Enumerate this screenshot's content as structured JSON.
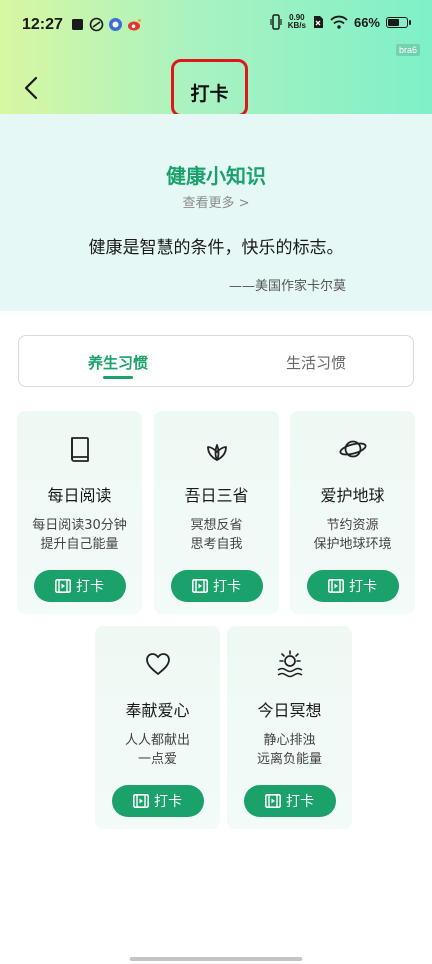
{
  "status_bar": {
    "time": "12:27",
    "net_speed_value": "0.90",
    "net_speed_unit": "KB/s",
    "battery_percent": "66%",
    "battery_level": 0.66,
    "device_tag": "bra6"
  },
  "header": {
    "title": "打卡",
    "back_icon": "chevron-left-icon"
  },
  "knowledge": {
    "title": "健康小知识",
    "more_link": "查看更多 >",
    "quote": "健康是智慧的条件，快乐的标志。",
    "author": "——美国作家卡尔莫"
  },
  "tabs": [
    {
      "label": "养生习惯",
      "active": true
    },
    {
      "label": "生活习惯",
      "active": false
    }
  ],
  "cards": [
    {
      "title": "每日阅读",
      "desc_line1": "每日阅读30分钟",
      "desc_line2": "提升自己能量",
      "button": "打卡",
      "icon": "book-icon"
    },
    {
      "title": "吾日三省",
      "desc_line1": "冥想反省",
      "desc_line2": "思考自我",
      "button": "打卡",
      "icon": "lotus-icon"
    },
    {
      "title": "爱护地球",
      "desc_line1": "节约资源",
      "desc_line2": "保护地球环境",
      "button": "打卡",
      "icon": "planet-icon"
    },
    {
      "title": "奉献爱心",
      "desc_line1": "人人都献出",
      "desc_line2": "一点爱",
      "button": "打卡",
      "icon": "heart-icon"
    },
    {
      "title": "今日冥想",
      "desc_line1": "静心排浊",
      "desc_line2": "远离负能量",
      "button": "打卡",
      "icon": "sunrise-icon"
    }
  ],
  "colors": {
    "accent": "#1aa26a",
    "highlight_border": "#e0161d",
    "banner_bg": "#e5f8f6",
    "card_bg": "#eef9f4"
  }
}
